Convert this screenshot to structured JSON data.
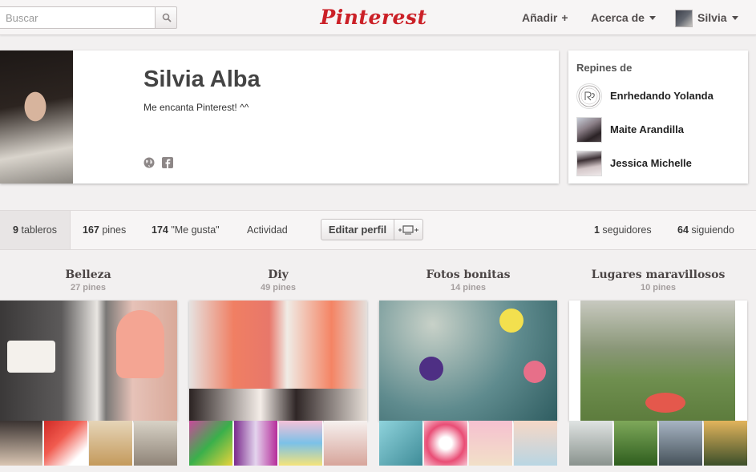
{
  "header": {
    "search_placeholder": "Buscar",
    "logo": "Pinterest",
    "add_label": "Añadir",
    "about_label": "Acerca de",
    "user_label": "Silvia"
  },
  "profile": {
    "name": "Silvia Alba",
    "bio": "Me encanta Pinterest! ^^"
  },
  "repins": {
    "title": "Repines de",
    "items": [
      {
        "name": "Enrhedando Yolanda"
      },
      {
        "name": "Maite Arandilla"
      },
      {
        "name": "Jessica Michelle"
      }
    ]
  },
  "tabs": {
    "boards_count": "9",
    "boards_label": " tableros",
    "pins_count": "167",
    "pins_label": " pines",
    "likes_count": "174",
    "likes_label": " \"Me gusta\"",
    "activity_label": "Actividad",
    "edit_label": "Editar perfil",
    "followers_count": "1",
    "followers_label": " seguidores",
    "following_count": "64",
    "following_label": " siguiendo"
  },
  "boards": [
    {
      "title": "Belleza",
      "count": "27 pines"
    },
    {
      "title": "Diy",
      "count": "49 pines"
    },
    {
      "title": "Fotos bonitas",
      "count": "14 pines"
    },
    {
      "title": "Lugares maravillosos",
      "count": "10 pines"
    }
  ],
  "colors": {
    "brand": "#cb2027",
    "background": "#f2f0f0",
    "text": "#333333"
  }
}
